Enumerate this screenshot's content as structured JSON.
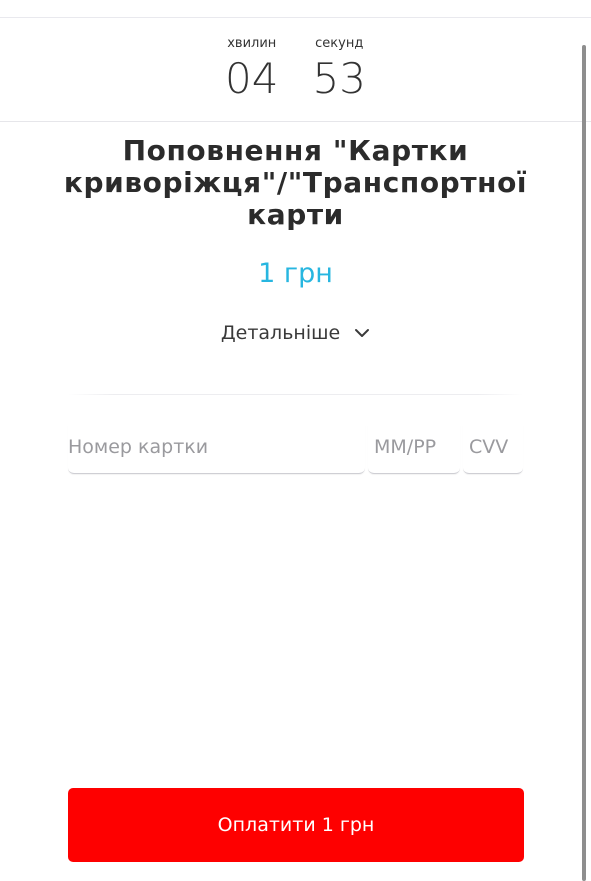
{
  "timer": {
    "minutes_label": "хвилин",
    "minutes_value": "04",
    "seconds_label": "секунд",
    "seconds_value": "53"
  },
  "payment": {
    "title": "Поповнення \"Картки криворіжця\"/\"Транспортної карти",
    "amount": "1 грн",
    "details_label": "Детальніше",
    "details_icon": "chevron-down-icon"
  },
  "form": {
    "card_number_placeholder": "Номер картки",
    "expiry_placeholder": "ММ/РР",
    "cvv_placeholder": "CVV"
  },
  "actions": {
    "pay_label": "Оплатити 1 грн"
  },
  "colors": {
    "accent_amount": "#27b6e0",
    "pay_button": "#fe0000"
  }
}
